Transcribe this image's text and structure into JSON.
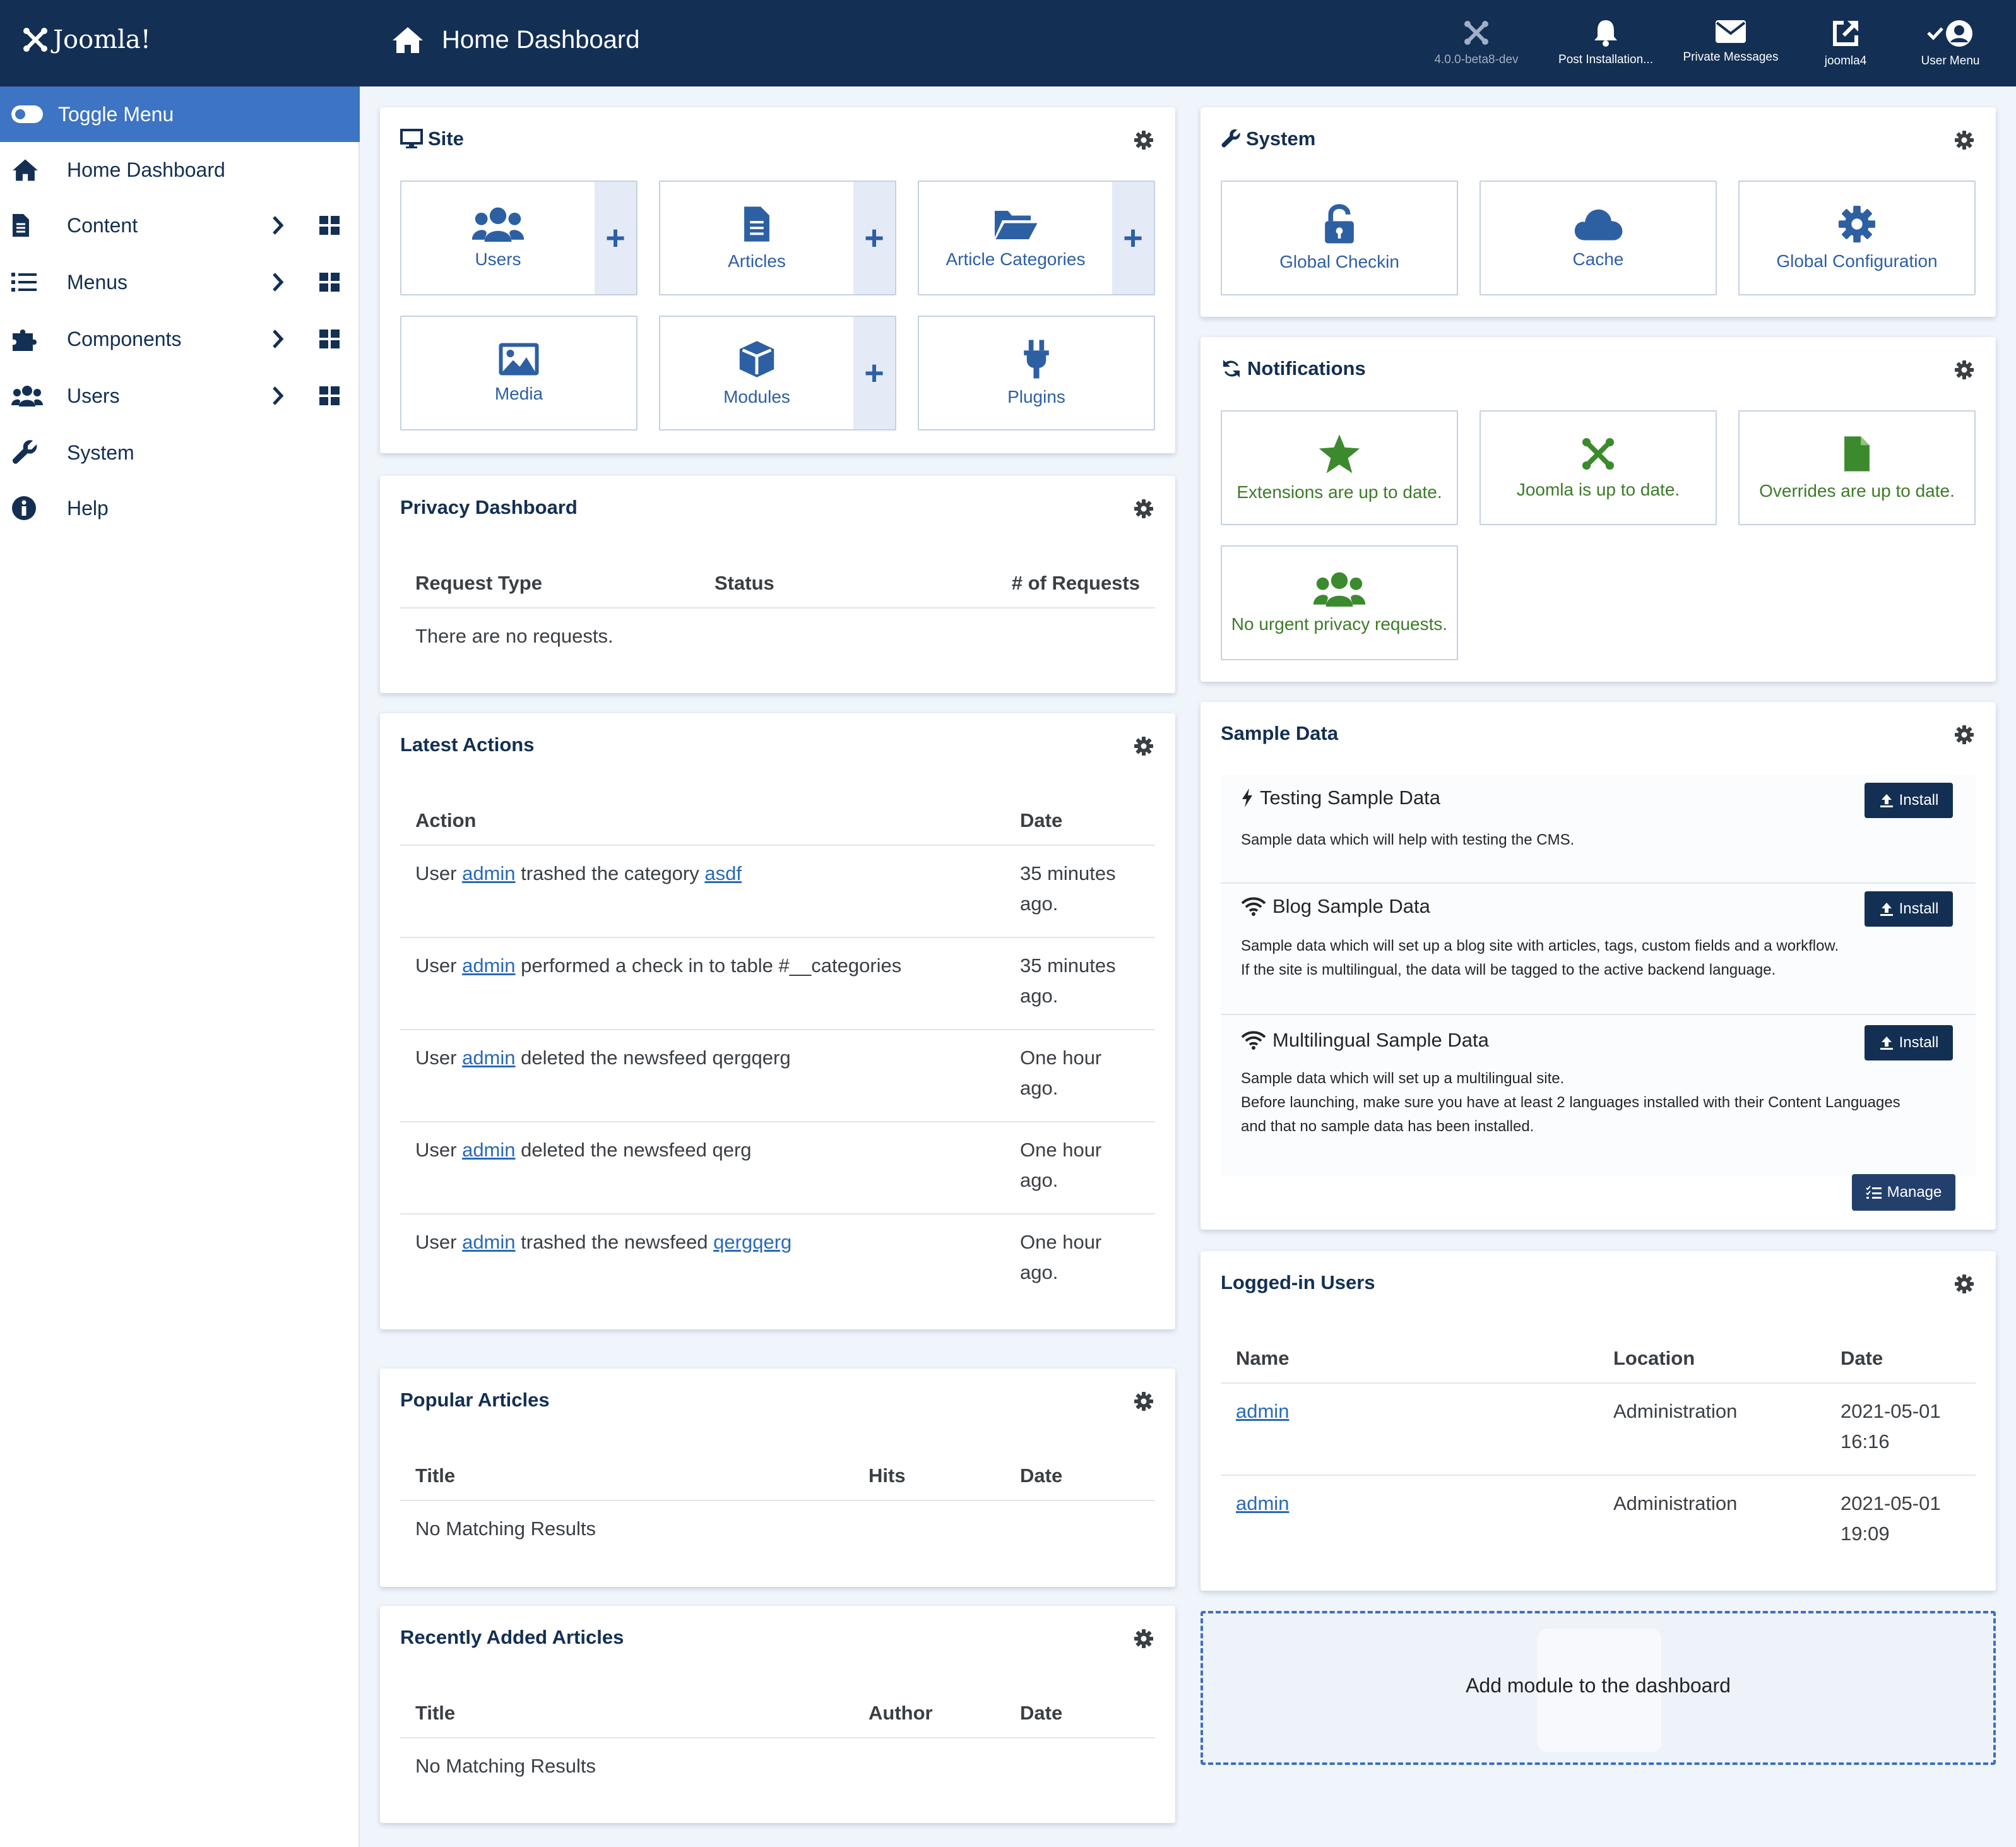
{
  "header": {
    "logo_text": "Joomla!",
    "title": "Home Dashboard",
    "items": [
      {
        "label": "4.0.0-beta8-dev",
        "icon": "joomla-icon"
      },
      {
        "label": "Post Installation...",
        "icon": "bell-icon"
      },
      {
        "label": "Private Messages",
        "icon": "envelope-icon"
      },
      {
        "label": "joomla4",
        "icon": "external-link-icon"
      },
      {
        "label": "User Menu",
        "icon": "user-circle-icon"
      }
    ]
  },
  "sidebar": {
    "toggle_label": "Toggle Menu",
    "items": [
      {
        "label": "Home Dashboard",
        "icon": "home-icon"
      },
      {
        "label": "Content",
        "icon": "file-icon"
      },
      {
        "label": "Menus",
        "icon": "list-icon"
      },
      {
        "label": "Components",
        "icon": "puzzle-icon"
      },
      {
        "label": "Users",
        "icon": "users-icon"
      },
      {
        "label": "System",
        "icon": "wrench-icon"
      },
      {
        "label": "Help",
        "icon": "info-icon"
      }
    ]
  },
  "site": {
    "title": "Site",
    "tiles": [
      {
        "label": "Users",
        "icon": "users-icon",
        "add": true
      },
      {
        "label": "Articles",
        "icon": "file-icon",
        "add": true
      },
      {
        "label": "Article Categories",
        "icon": "folder-open-icon",
        "add": true
      },
      {
        "label": "Media",
        "icon": "image-icon",
        "add": false
      },
      {
        "label": "Modules",
        "icon": "cube-icon",
        "add": true
      },
      {
        "label": "Plugins",
        "icon": "plug-icon",
        "add": false
      }
    ],
    "add_symbol": "+"
  },
  "system_card": {
    "title": "System",
    "tiles": [
      {
        "label": "Global Checkin",
        "icon": "unlock-icon"
      },
      {
        "label": "Cache",
        "icon": "cloud-icon"
      },
      {
        "label": "Global Configuration",
        "icon": "cog-icon"
      }
    ]
  },
  "notifications": {
    "title": "Notifications",
    "tiles": [
      {
        "label": "Extensions are up to date.",
        "icon": "star-icon"
      },
      {
        "label": "Joomla is up to date.",
        "icon": "joomla-icon"
      },
      {
        "label": "Overrides are up to date.",
        "icon": "file-icon"
      },
      {
        "label": "No urgent privacy requests.",
        "icon": "users-icon"
      }
    ]
  },
  "privacy": {
    "title": "Privacy Dashboard",
    "columns": [
      "Request Type",
      "Status",
      "# of Requests"
    ],
    "empty": "There are no requests."
  },
  "latest_actions": {
    "title": "Latest Actions",
    "columns": [
      "Action",
      "Date"
    ],
    "rows": [
      {
        "pre": "User ",
        "user": "admin",
        "mid": " trashed the category ",
        "link": "asdf",
        "date_1": "35 minutes",
        "date_2": "ago."
      },
      {
        "pre": "User ",
        "user": "admin",
        "mid": " performed a check in to table #__categories",
        "link": "",
        "date_1": "35 minutes",
        "date_2": "ago."
      },
      {
        "pre": "User ",
        "user": "admin",
        "mid": " deleted the newsfeed qergqerg",
        "link": "",
        "date_1": "One hour",
        "date_2": "ago."
      },
      {
        "pre": "User ",
        "user": "admin",
        "mid": " deleted the newsfeed qerg",
        "link": "",
        "date_1": "One hour",
        "date_2": "ago."
      },
      {
        "pre": "User ",
        "user": "admin",
        "mid": " trashed the newsfeed ",
        "link": "qergqerg",
        "date_1": "One hour",
        "date_2": "ago."
      }
    ]
  },
  "popular": {
    "title": "Popular Articles",
    "columns": [
      "Title",
      "Hits",
      "Date"
    ],
    "empty": "No Matching Results"
  },
  "recent": {
    "title": "Recently Added Articles",
    "columns": [
      "Title",
      "Author",
      "Date"
    ],
    "empty": "No Matching Results"
  },
  "sample_data": {
    "title": "Sample Data",
    "install_label": "Install",
    "manage_label": "Manage",
    "items": [
      {
        "title": "Testing Sample Data",
        "icon": "bolt-icon",
        "lines": [
          "Sample data which will help with testing the CMS."
        ]
      },
      {
        "title": "Blog Sample Data",
        "icon": "wifi-icon",
        "lines": [
          "Sample data which will set up a blog site with articles, tags, custom fields and a workflow.",
          "If the site is multilingual, the data will be tagged to the active backend language."
        ]
      },
      {
        "title": "Multilingual Sample Data",
        "icon": "wifi-icon",
        "lines": [
          "Sample data which will set up a multilingual site.",
          "Before launching, make sure you have at least 2 languages installed with their Content Languages",
          "and that no sample data has been installed."
        ]
      }
    ]
  },
  "logged_in": {
    "title": "Logged-in Users",
    "columns": [
      "Name",
      "Location",
      "Date"
    ],
    "rows": [
      {
        "name": "admin",
        "location": "Administration",
        "date_1": "2021-05-01",
        "date_2": "16:16"
      },
      {
        "name": "admin",
        "location": "Administration",
        "date_1": "2021-05-01",
        "date_2": "19:09"
      }
    ]
  },
  "add_module_label": "Add module to the dashboard",
  "colors": {
    "header": "#132f53",
    "accent": "#3d74c4",
    "tile_text": "#2d5fa3",
    "ok_green": "#3c7b29"
  }
}
